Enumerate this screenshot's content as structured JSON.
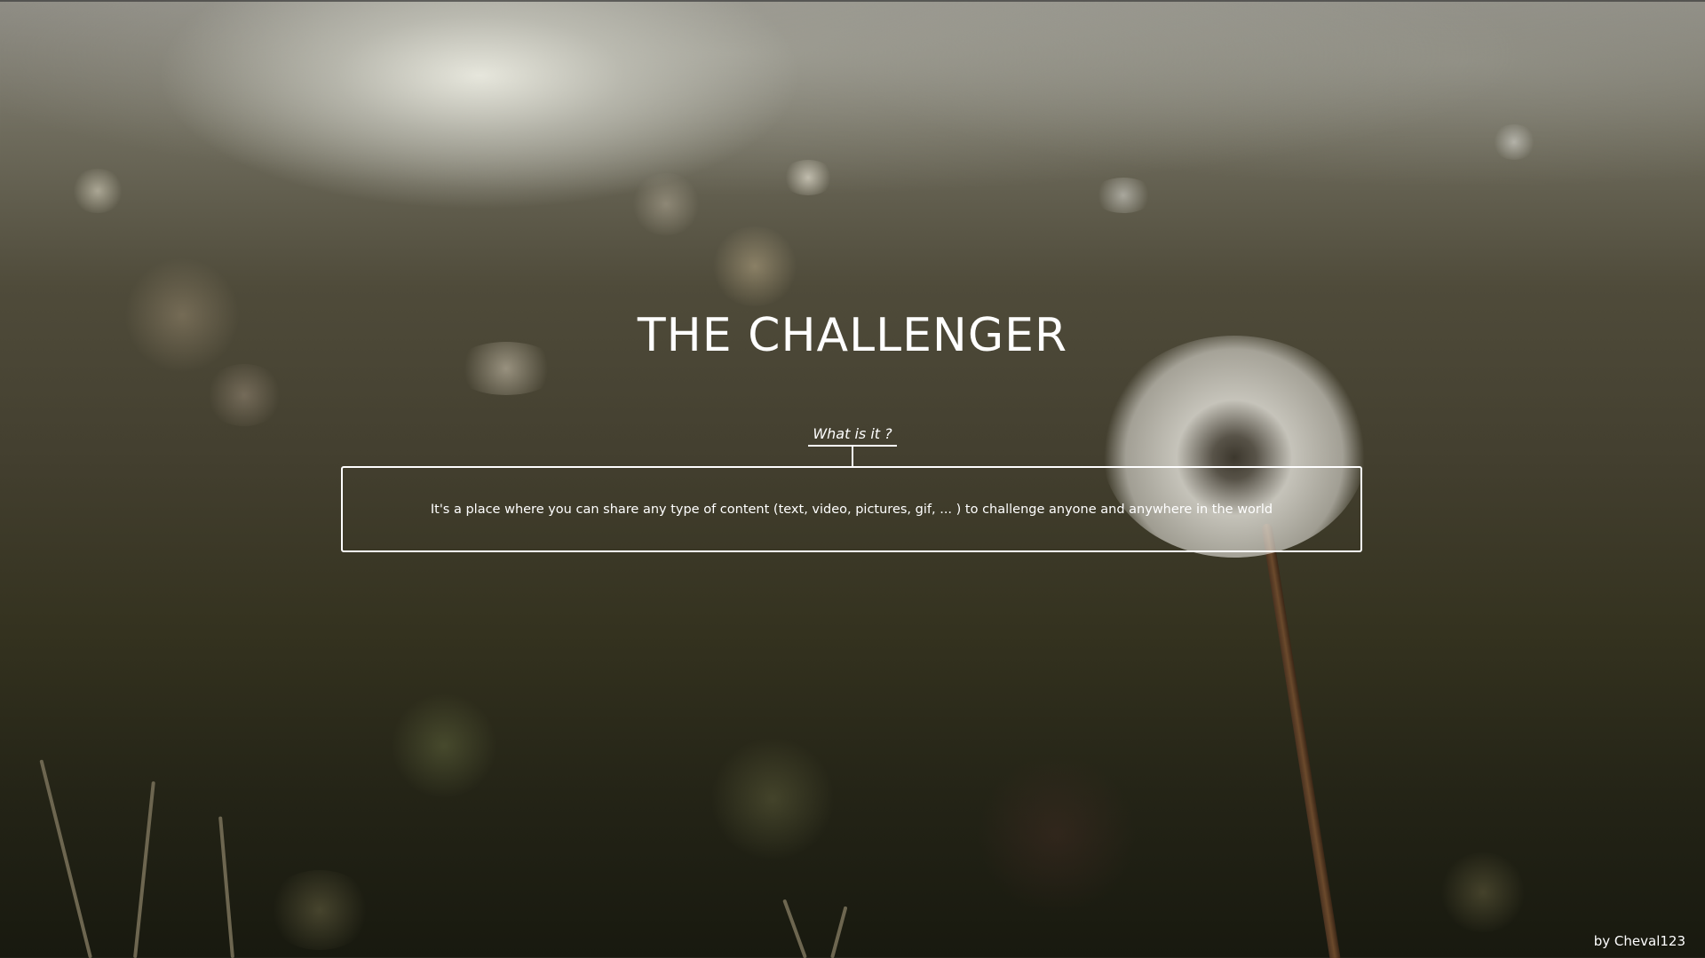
{
  "hero": {
    "title": "THE CHALLENGER",
    "link_label": "What is it ?",
    "description": "It's a place where you can share any type of content (text, video, pictures, gif, ... ) to challenge anyone and anywhere in the world"
  },
  "footer": {
    "credit": "by Cheval123"
  },
  "colors": {
    "text": "#ffffff",
    "background_dark": "#34321f",
    "background_light": "#8f8d85"
  }
}
